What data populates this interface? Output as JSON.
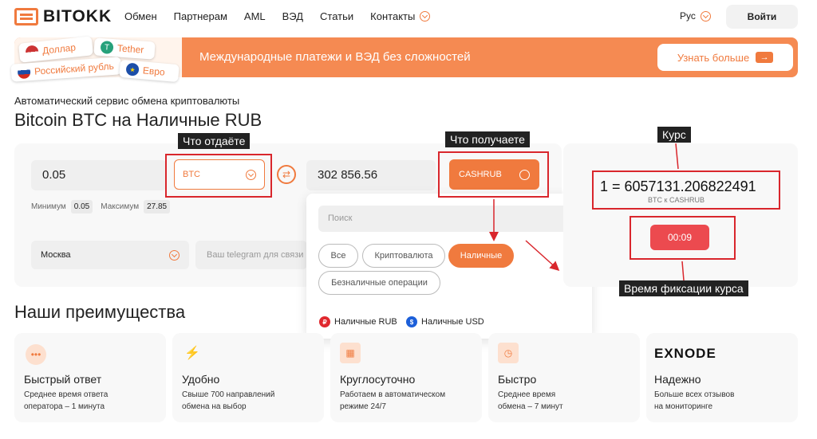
{
  "header": {
    "logo": "BITOKK",
    "nav": [
      "Обмен",
      "Партнерам",
      "AML",
      "ВЭД",
      "Статьи",
      "Контакты"
    ],
    "lang": "Рус",
    "login": "Войти"
  },
  "banner": {
    "cards": [
      "Доллар",
      "Tether",
      "Российский рубль",
      "Евро"
    ],
    "text": "Международные платежи и ВЭД без сложностей",
    "button": "Узнать больше"
  },
  "page": {
    "subtitle": "Автоматический сервис обмена криптовалюты",
    "title": "Bitcoin BTC на Наличные RUB"
  },
  "exchange": {
    "give_amount": "0.05",
    "give_currency": "BTC",
    "get_amount": "302 856.56",
    "get_currency": "CASHRUB",
    "min_label": "Минимум",
    "min_value": "0.05",
    "max_label": "Максимум",
    "max_value": "27.85",
    "city": "Москва",
    "telegram_placeholder": "Ваш telegram для связи"
  },
  "dropdown": {
    "search_placeholder": "Поиск",
    "chips": [
      "Все",
      "Криптовалюта",
      "Наличные",
      "Безналичные операции"
    ],
    "active_chip": "Наличные",
    "options": [
      "Наличные RUB",
      "Наличные USD"
    ]
  },
  "rate": {
    "value": "1 = 6057131.206822491",
    "sub": "BTC к CASHRUB",
    "timer": "00:09"
  },
  "annotations": {
    "give": "Что отдаёте",
    "get": "Что получаете",
    "rate": "Курс",
    "timer": "Время фиксации курса"
  },
  "advantages": {
    "title": "Наши преимущества",
    "items": [
      {
        "name": "Быстрый ответ",
        "desc1": "Среднее время ответа",
        "desc2": "оператора – 1 минута"
      },
      {
        "name": "Удобно",
        "desc1": "Свыше 700 направлений",
        "desc2": "обмена на выбор"
      },
      {
        "name": "Круглосуточно",
        "desc1": "Работаем в автоматическом",
        "desc2": "режиме 24/7"
      },
      {
        "name": "Быстро",
        "desc1": "Среднее время",
        "desc2": "обмена – 7 минут"
      },
      {
        "name": "Надежно",
        "desc1": "Больше всех отзывов",
        "desc2": "на мониторинге",
        "logo": "EXNODE"
      }
    ]
  },
  "colors": {
    "accent": "#f07a3e",
    "danger": "#ec4a4f",
    "annotation": "#d9262c"
  }
}
